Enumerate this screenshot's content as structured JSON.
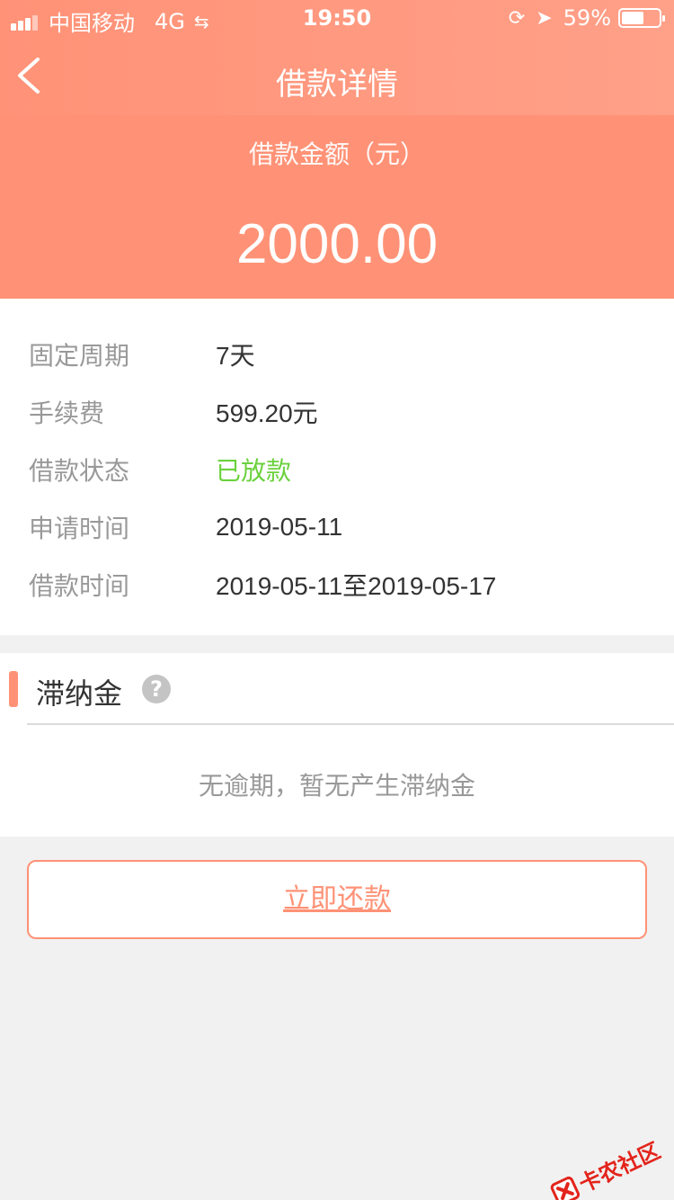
{
  "status_bar": {
    "carrier": "中国移动",
    "network": "4G",
    "time": "19:50",
    "battery": "59%",
    "battery_level": 0.59
  },
  "nav": {
    "title": "借款详情"
  },
  "amount": {
    "label": "借款金额（元）",
    "value": "2000.00"
  },
  "details": [
    {
      "label": "固定周期",
      "value": "7天"
    },
    {
      "label": "手续费",
      "value": "599.20元"
    },
    {
      "label": "借款状态",
      "value": "已放款"
    },
    {
      "label": "申请时间",
      "value": "2019-05-11"
    },
    {
      "label": "借款时间",
      "value": "2019-05-11至2019-05-17"
    }
  ],
  "late_fee": {
    "title": "滞纳金",
    "help": "?",
    "message": "无逾期，暂无产生滞纳金"
  },
  "repay_button": {
    "label": "立即还款"
  },
  "watermark": {
    "text": "卡农社区"
  },
  "colors": {
    "accent": "#ff9276",
    "status_green": "#6bd13c",
    "text_muted": "#999999",
    "text_main": "#333333"
  }
}
